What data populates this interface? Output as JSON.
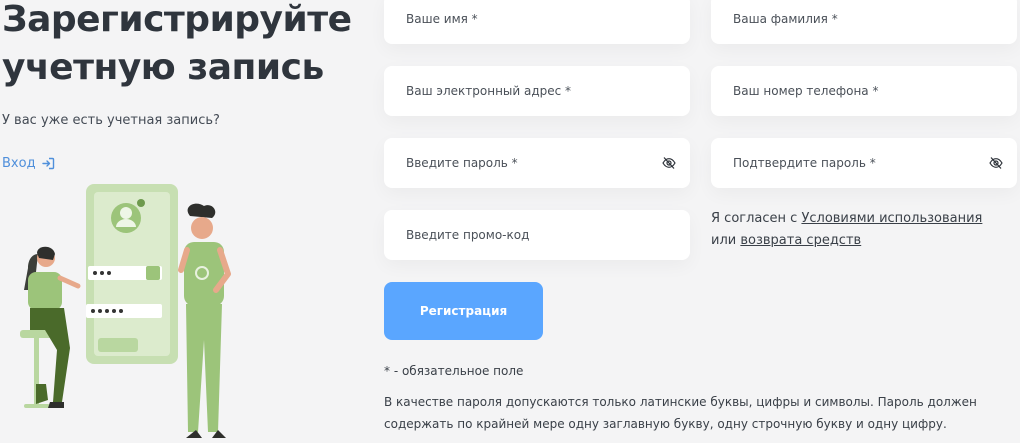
{
  "header": {
    "title_line1": "Зарегистрируйте",
    "title_line2": "учетную запись",
    "subtitle": "У вас уже есть учетная запись?",
    "login_label": "Вход"
  },
  "form": {
    "first_name_placeholder": "Ваше имя *",
    "last_name_placeholder": "Ваша фамилия *",
    "email_placeholder": "Ваш электронный адрес *",
    "phone_placeholder": "Ваш номер телефона *",
    "password_placeholder": "Введите пароль *",
    "confirm_password_placeholder": "Подтвердите пароль *",
    "promo_placeholder": "Введите промо-код",
    "agree_prefix": "Я согласен с ",
    "terms_link": "Условиями использования",
    "agree_or": " или ",
    "refund_link": "возврата средств",
    "submit_label": "Регистрация",
    "required_note": "* - обязательное поле",
    "password_rules": "В качестве пароля допускаются только латинские буквы, цифры и символы. Пароль должен содержать по крайней мере одну заглавную букву, одну строчную букву и одну цифру."
  },
  "colors": {
    "accent": "#5aa6ff",
    "link": "#4f8fdb",
    "illustration_green": "#9cc47a"
  }
}
